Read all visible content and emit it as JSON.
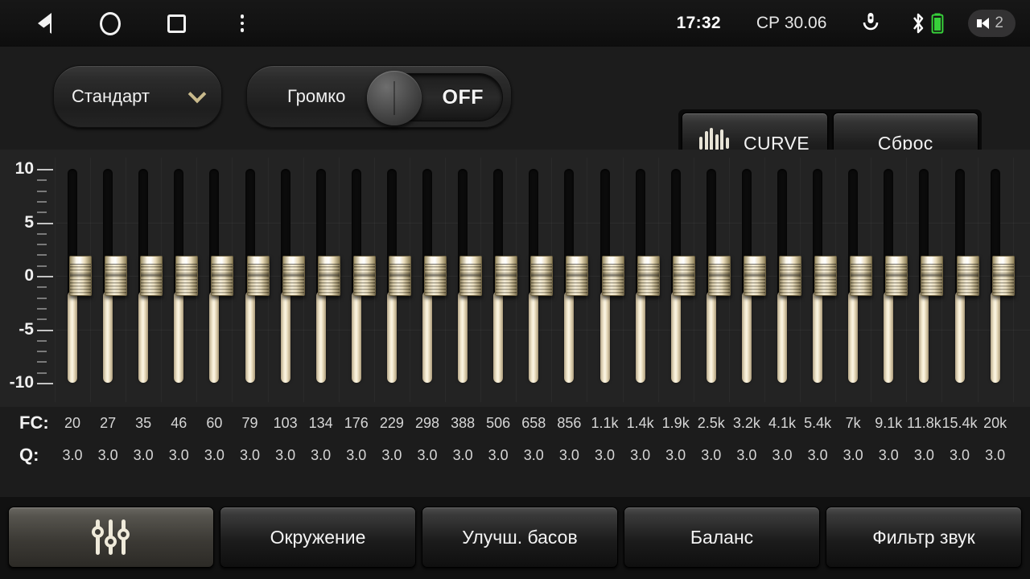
{
  "statusbar": {
    "nav": [
      {
        "name": "back-icon",
        "label": "back"
      },
      {
        "name": "home-icon",
        "label": "home"
      },
      {
        "name": "recents-icon",
        "label": "recents"
      },
      {
        "name": "overflow-menu-icon",
        "label": "menu"
      }
    ],
    "clock": "17:32",
    "date": "СР 30.06",
    "mic_icon": "microphone-icon",
    "bluetooth_icon": "bluetooth-icon",
    "battery_icon": "battery-icon",
    "battery_color": "#37d13a",
    "volume_icon": "speaker-icon",
    "volume_value": "2"
  },
  "toolbar": {
    "preset_label": "Стандарт",
    "preset_chevron": "chevron-down-icon",
    "preset_chevron_color": "#c9ba8c",
    "loudness_label": "Громко",
    "loudness_state": "OFF",
    "curve_label": "CURVE",
    "curve_icon": "waveform-icon",
    "reset_label": "Сброс"
  },
  "equalizer": {
    "y_axis": {
      "labels": [
        "10",
        "5",
        "0",
        "-5",
        "-10"
      ],
      "values": [
        10,
        5,
        0,
        -5,
        -10
      ],
      "min": -10,
      "max": 10
    },
    "fc_row_label": "FC:",
    "q_row_label": "Q:",
    "bands": [
      {
        "fc": "20",
        "q": "3.0",
        "gain": 0
      },
      {
        "fc": "27",
        "q": "3.0",
        "gain": 0
      },
      {
        "fc": "35",
        "q": "3.0",
        "gain": 0
      },
      {
        "fc": "46",
        "q": "3.0",
        "gain": 0
      },
      {
        "fc": "60",
        "q": "3.0",
        "gain": 0
      },
      {
        "fc": "79",
        "q": "3.0",
        "gain": 0
      },
      {
        "fc": "103",
        "q": "3.0",
        "gain": 0
      },
      {
        "fc": "134",
        "q": "3.0",
        "gain": 0
      },
      {
        "fc": "176",
        "q": "3.0",
        "gain": 0
      },
      {
        "fc": "229",
        "q": "3.0",
        "gain": 0
      },
      {
        "fc": "298",
        "q": "3.0",
        "gain": 0
      },
      {
        "fc": "388",
        "q": "3.0",
        "gain": 0
      },
      {
        "fc": "506",
        "q": "3.0",
        "gain": 0
      },
      {
        "fc": "658",
        "q": "3.0",
        "gain": 0
      },
      {
        "fc": "856",
        "q": "3.0",
        "gain": 0
      },
      {
        "fc": "1.1k",
        "q": "3.0",
        "gain": 0
      },
      {
        "fc": "1.4k",
        "q": "3.0",
        "gain": 0
      },
      {
        "fc": "1.9k",
        "q": "3.0",
        "gain": 0
      },
      {
        "fc": "2.5k",
        "q": "3.0",
        "gain": 0
      },
      {
        "fc": "3.2k",
        "q": "3.0",
        "gain": 0
      },
      {
        "fc": "4.1k",
        "q": "3.0",
        "gain": 0
      },
      {
        "fc": "5.4k",
        "q": "3.0",
        "gain": 0
      },
      {
        "fc": "7k",
        "q": "3.0",
        "gain": 0
      },
      {
        "fc": "9.1k",
        "q": "3.0",
        "gain": 0
      },
      {
        "fc": "11.8k",
        "q": "3.0",
        "gain": 0
      },
      {
        "fc": "15.4k",
        "q": "3.0",
        "gain": 0
      },
      {
        "fc": "20k",
        "q": "3.0",
        "gain": 0
      }
    ]
  },
  "tabs": [
    {
      "label": "",
      "icon": "equalizer-sliders-icon",
      "active": true
    },
    {
      "label": "Окружение",
      "icon": "",
      "active": false
    },
    {
      "label": "Улучш. басов",
      "icon": "",
      "active": false
    },
    {
      "label": "Баланс",
      "icon": "",
      "active": false
    },
    {
      "label": "Фильтр звук",
      "icon": "",
      "active": false
    }
  ],
  "colors": {
    "accent_gold": "#c9ba8c",
    "slider_fill": "#f2e8cd",
    "panel_bg": "#232323",
    "page_bg": "#1c1c1c"
  }
}
